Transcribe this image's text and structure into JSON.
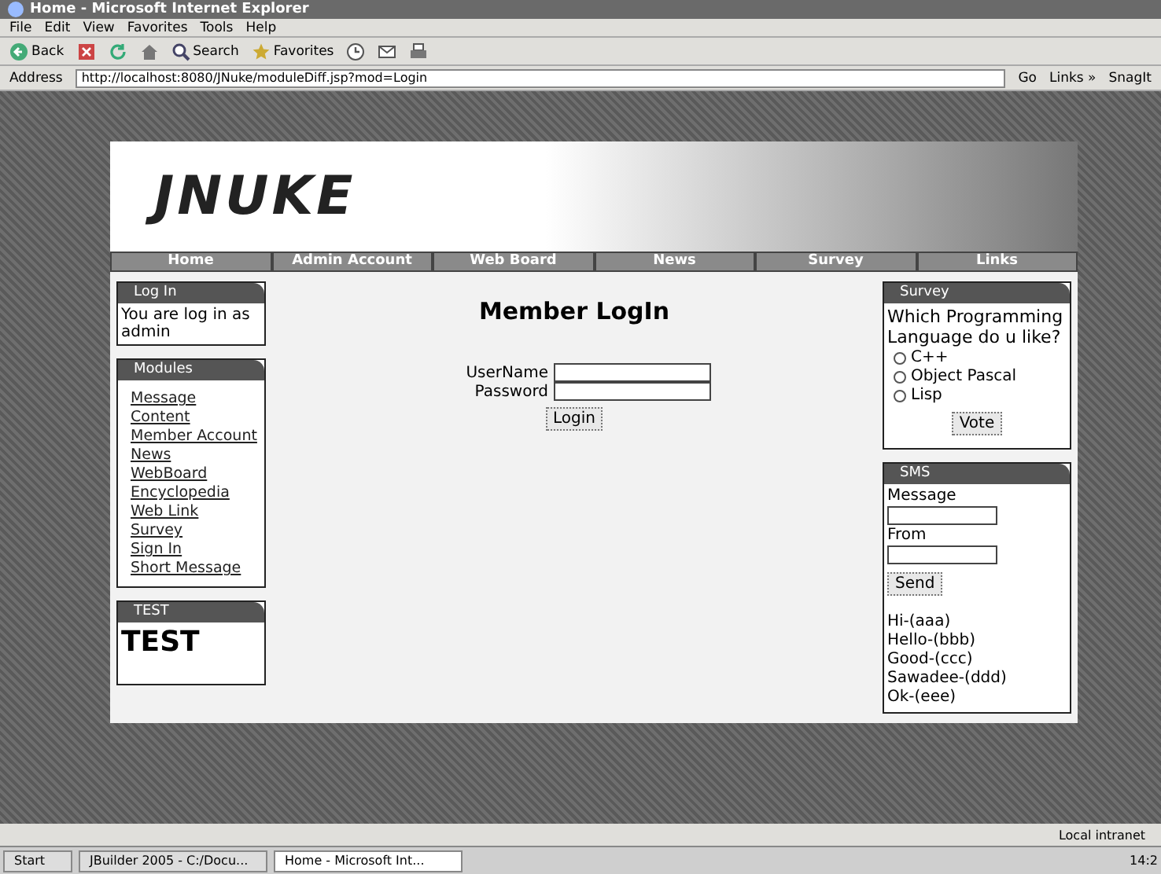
{
  "window": {
    "title": "Home - Microsoft Internet Explorer"
  },
  "menu": [
    "File",
    "Edit",
    "View",
    "Favorites",
    "Tools",
    "Help"
  ],
  "toolbar": [
    {
      "kind": "back",
      "label": "Back"
    },
    {
      "kind": "stop"
    },
    {
      "kind": "refresh"
    },
    {
      "kind": "home"
    },
    {
      "kind": "search",
      "label": "Search"
    },
    {
      "kind": "favorites",
      "label": "Favorites"
    },
    {
      "kind": "history"
    },
    {
      "kind": "mail"
    },
    {
      "kind": "print"
    }
  ],
  "address": {
    "label": "Address",
    "url": "http://localhost:8080/JNuke/moduleDiff.jsp?mod=Login",
    "go": "Go",
    "links": "Links »",
    "snagit": "SnagIt"
  },
  "site": {
    "logo": "JNUKE",
    "nav": [
      "Home",
      "Admin Account",
      "Web Board",
      "News",
      "Survey",
      "Links"
    ],
    "login_box": {
      "title": "Log In",
      "text": "You are log in as admin"
    },
    "modules_box": {
      "title": "Modules",
      "items": [
        "Message",
        "Content",
        "Member Account",
        "News",
        "WebBoard",
        "Encyclopedia",
        "Web Link",
        "Survey",
        "Sign In",
        "Short Message"
      ]
    },
    "test_box": {
      "title": "TEST",
      "text": "TEST"
    },
    "login_form": {
      "heading": "Member LogIn",
      "fields": [
        {
          "label": "UserName"
        },
        {
          "label": "Password"
        }
      ],
      "button": "Login"
    },
    "survey_box": {
      "title": "Survey",
      "question": "Which Programming Language do u like?",
      "options": [
        {
          "label": "C++",
          "selected": false
        },
        {
          "label": "Object Pascal",
          "selected": false
        },
        {
          "label": "Lisp",
          "selected": false
        }
      ],
      "button": "Vote"
    },
    "sms_box": {
      "title": "SMS",
      "fields": [
        {
          "label": "Message"
        },
        {
          "label": "From"
        }
      ],
      "button": "Send",
      "messages": [
        "Hi-(aaa)",
        "Hello-(bbb)",
        "Good-(ccc)",
        "Sawadee-(ddd)",
        "Ok-(eee)"
      ]
    }
  },
  "status_bar": {
    "zone": "Local intranet"
  },
  "taskbar": {
    "start": "Start",
    "tasks": [
      {
        "label": "JBuilder 2005 - C:/Docu...",
        "selected": false
      },
      {
        "label": "Home - Microsoft Int...",
        "selected": true
      }
    ],
    "clock": "14:2"
  }
}
